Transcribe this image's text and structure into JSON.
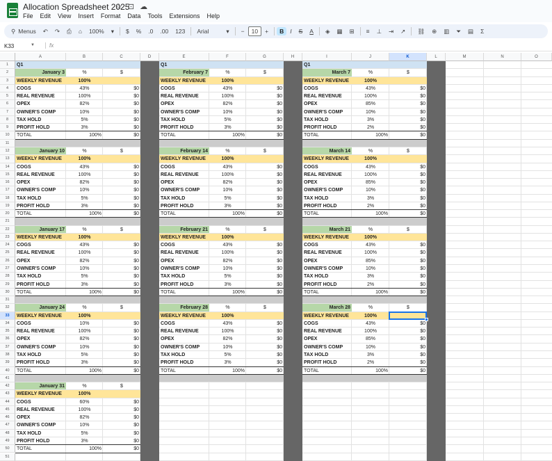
{
  "app": {
    "title": "Allocation Spreadsheet 2025",
    "menus": [
      "File",
      "Edit",
      "View",
      "Insert",
      "Format",
      "Data",
      "Tools",
      "Extensions",
      "Help"
    ]
  },
  "toolbar": {
    "menus_label": "Menus",
    "zoom": "100%",
    "currency": "$",
    "percent": "%",
    "dec_decrease": ".0",
    "dec_increase": ".00",
    "number_format": "123",
    "font": "Arial",
    "font_size": "10",
    "bold": "B"
  },
  "formula_bar": {
    "cell_ref": "K33",
    "fx": "fx",
    "content": ""
  },
  "columns": [
    "A",
    "B",
    "C",
    "D",
    "E",
    "F",
    "G",
    "H",
    "I",
    "J",
    "K",
    "L",
    "M",
    "N",
    "O"
  ],
  "selected_cell": "K33",
  "colors": {
    "header_blue": "#cfe2f3",
    "date_green": "#b6d7a8",
    "weekly_yellow": "#ffe599",
    "separator_dark": "#666666",
    "separator_gray": "#cccccc",
    "selection": "#1a73e8"
  },
  "sheet": {
    "quarter_label": "Q1",
    "pct_header": "%",
    "amount_header": "$",
    "weekly_revenue_label": "WEEKLY REVENUE",
    "weekly_revenue_pct": "100%",
    "total_label": "TOTAL",
    "total_pct": "100%",
    "zero_value": "$0",
    "line_items": [
      "COGS",
      "REAL REVENUE",
      "OPEX",
      "OWNER'S COMP",
      "TAX HOLD",
      "PROFIT HOLD"
    ],
    "blocks": [
      {
        "date": "January 3",
        "pcts": [
          "43%",
          "100%",
          "82%",
          "10%",
          "5%",
          "3%"
        ]
      },
      {
        "date": "February 7",
        "pcts": [
          "43%",
          "100%",
          "82%",
          "10%",
          "5%",
          "3%"
        ]
      },
      {
        "date": "March 7",
        "pcts": [
          "43%",
          "100%",
          "85%",
          "10%",
          "3%",
          "2%"
        ]
      },
      {
        "date": "January 10",
        "pcts": [
          "43%",
          "100%",
          "82%",
          "10%",
          "5%",
          "3%"
        ]
      },
      {
        "date": "February 14",
        "pcts": [
          "43%",
          "100%",
          "82%",
          "10%",
          "5%",
          "3%"
        ]
      },
      {
        "date": "March 14",
        "pcts": [
          "43%",
          "100%",
          "85%",
          "10%",
          "3%",
          "2%"
        ]
      },
      {
        "date": "January 17",
        "pcts": [
          "43%",
          "100%",
          "82%",
          "10%",
          "5%",
          "3%"
        ]
      },
      {
        "date": "February 21",
        "pcts": [
          "43%",
          "100%",
          "82%",
          "10%",
          "5%",
          "3%"
        ]
      },
      {
        "date": "March 21",
        "pcts": [
          "43%",
          "100%",
          "85%",
          "10%",
          "3%",
          "2%"
        ]
      },
      {
        "date": "January 24",
        "pcts": [
          "10%",
          "100%",
          "82%",
          "10%",
          "5%",
          "3%"
        ]
      },
      {
        "date": "February 28",
        "pcts": [
          "43%",
          "100%",
          "82%",
          "10%",
          "5%",
          "3%"
        ]
      },
      {
        "date": "March 28",
        "pcts": [
          "43%",
          "100%",
          "85%",
          "10%",
          "3%",
          "2%"
        ]
      },
      {
        "date": "January 31",
        "pcts": [
          "60%",
          "100%",
          "82%",
          "10%",
          "5%",
          "3%"
        ]
      }
    ]
  }
}
